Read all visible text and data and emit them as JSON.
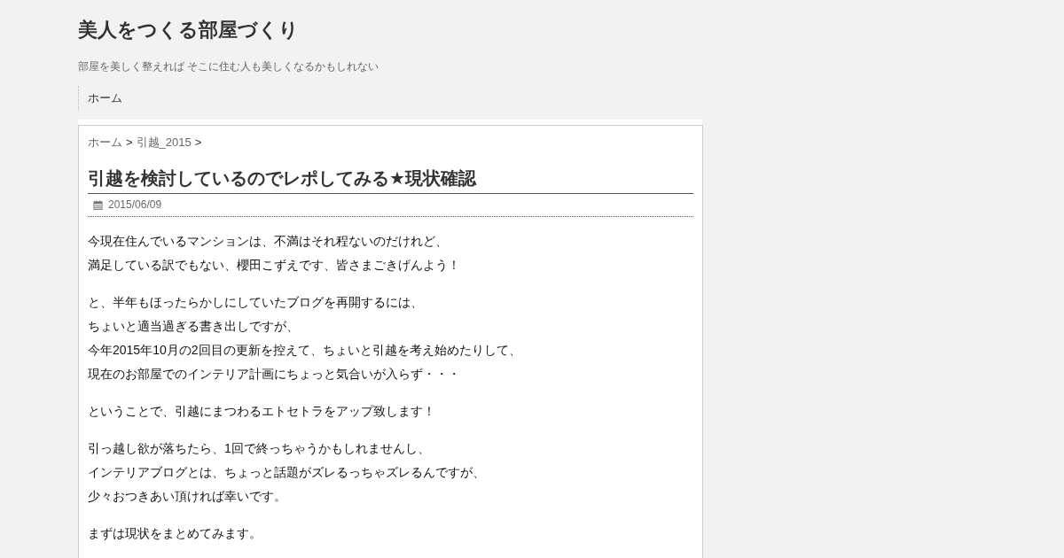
{
  "site": {
    "title": "美人をつくる部屋づくり",
    "tagline": "部屋を美しく整えれば そこに住む人も美しくなるかもしれない"
  },
  "nav": [
    {
      "label": "ホーム"
    }
  ],
  "breadcrumb": [
    {
      "kind": "link",
      "text": "ホーム"
    },
    {
      "kind": "separator",
      "text": ">"
    },
    {
      "kind": "link",
      "text": "引越_2015"
    },
    {
      "kind": "separator",
      "text": ">"
    }
  ],
  "post": {
    "title": "引越を検討しているのでレポしてみる★現状確認",
    "date": "2015/06/09",
    "paragraphs": [
      [
        "今現在住んでいるマンションは、不満はそれ程ないのだけれど、",
        "満足している訳でもない、櫻田こずえです、皆さまごきげんよう！"
      ],
      [
        "と、半年もほったらかしにしていたブログを再開するには、",
        "ちょいと適当過ぎる書き出しですが、",
        "今年2015年10月の2回目の更新を控えて、ちょいと引越を考え始めたりして、",
        "現在のお部屋でのインテリア計画にちょっと気合いが入らず・・・"
      ],
      [
        "ということで、引越にまつわるエトセトラをアップ致します！"
      ],
      [
        "引っ越し欲が落ちたら、1回で終っちゃうかもしれませんし、",
        "インテリアブログとは、ちょっと話題がズレるっちゃズレるんですが、",
        "少々おつきあい頂ければ幸いです。"
      ],
      [
        "まずは現状をまとめてみます。"
      ]
    ]
  }
}
